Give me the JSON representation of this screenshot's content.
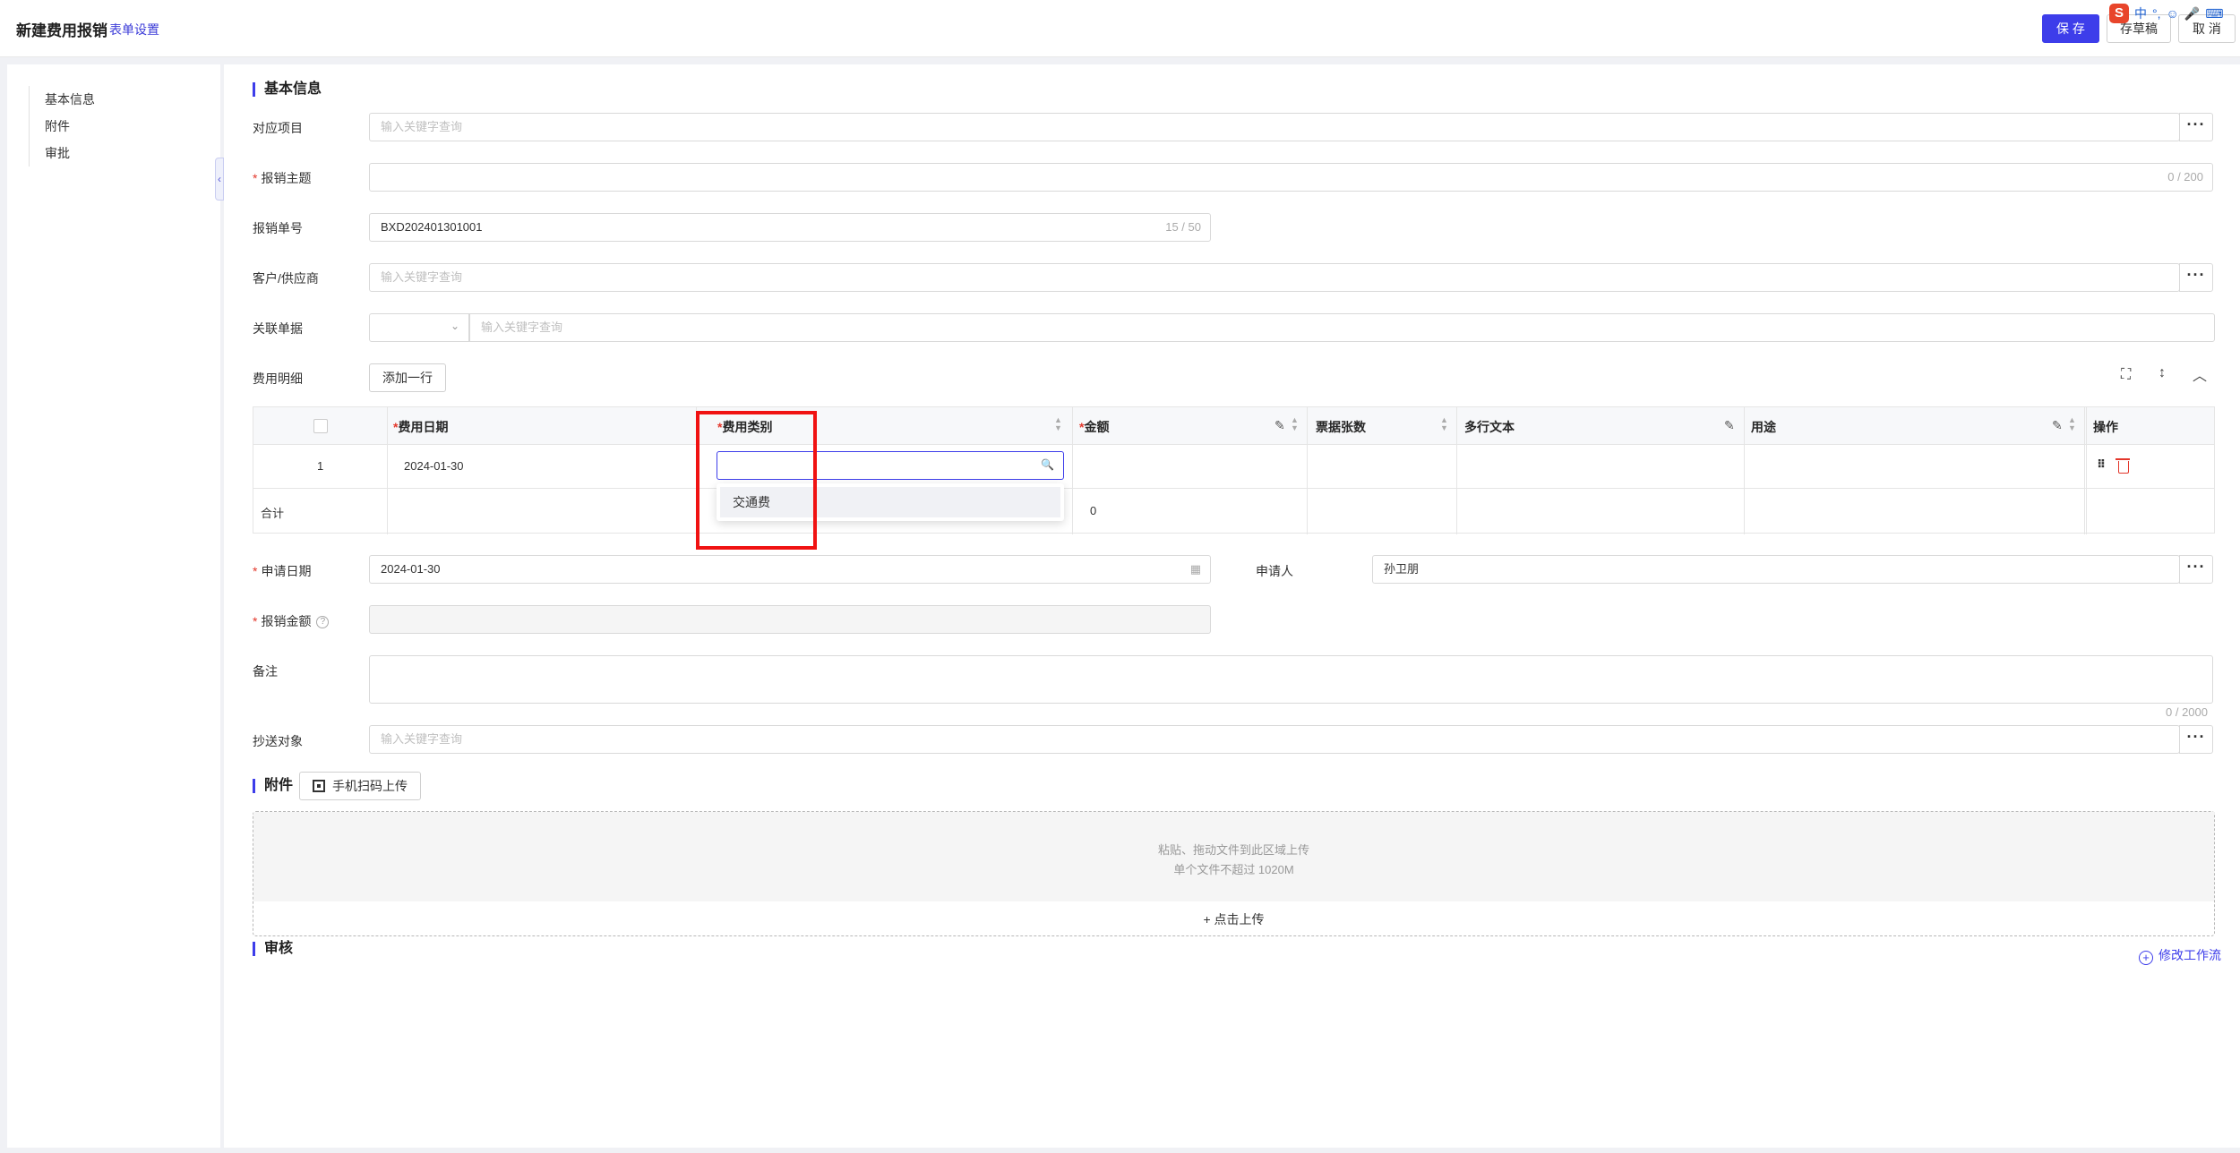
{
  "header": {
    "title": "新建费用报销",
    "form_settings": "表单设置",
    "save": "保 存",
    "draft": "存草稿",
    "cancel": "取 消"
  },
  "ime_toolbar": {
    "logo": "S",
    "lang": "中",
    "punct": "°,"
  },
  "sidebar": {
    "items": [
      {
        "label": "基本信息"
      },
      {
        "label": "附件"
      },
      {
        "label": "审批"
      }
    ],
    "collapse_glyph": "‹"
  },
  "basic_info": {
    "section_title": "基本信息",
    "project": {
      "label": "对应项目",
      "placeholder": "输入关键字查询"
    },
    "subject": {
      "label": "报销主题",
      "value": "",
      "counter": "0 / 200"
    },
    "number": {
      "label": "报销单号",
      "value": "BXD202401301001",
      "counter": "15 / 50"
    },
    "partner": {
      "label": "客户/供应商",
      "placeholder": "输入关键字查询"
    },
    "related": {
      "label": "关联单据",
      "placeholder": "输入关键字查询"
    },
    "details": {
      "label": "费用明细",
      "add_row": "添加一行"
    }
  },
  "grid": {
    "columns": {
      "date": "费用日期",
      "category": "费用类别",
      "amount": "金额",
      "tickets": "票据张数",
      "multiline": "多行文本",
      "purpose": "用途",
      "action": "操作"
    },
    "rows": [
      {
        "index": "1",
        "date": "2024-01-30",
        "category": "",
        "amount": "",
        "tickets": "",
        "multiline": "",
        "purpose": ""
      }
    ],
    "total": {
      "label": "合计",
      "amount": "0"
    },
    "dropdown_option": "交通费"
  },
  "apply": {
    "date": {
      "label": "申请日期",
      "value": "2024-01-30"
    },
    "applicant": {
      "label": "申请人",
      "value": "孙卫朋"
    },
    "amount": {
      "label": "报销金额",
      "help": "?"
    },
    "remark": {
      "label": "备注",
      "counter": "0 / 2000"
    },
    "cc": {
      "label": "抄送对象",
      "placeholder": "输入关键字查询"
    }
  },
  "attachment": {
    "section_title": "附件",
    "qr_upload": "手机扫码上传",
    "hint1": "粘贴、拖动文件到此区域上传",
    "hint2": "单个文件不超过 1020M",
    "click_upload": "点击上传",
    "plus": "+"
  },
  "review": {
    "section_title": "审核",
    "edit_workflow": "修改工作流",
    "plus": "+"
  },
  "dots": "···",
  "colors": {
    "primary": "#3d3dea",
    "required": "#e3372b",
    "highlight": "#f01212"
  }
}
